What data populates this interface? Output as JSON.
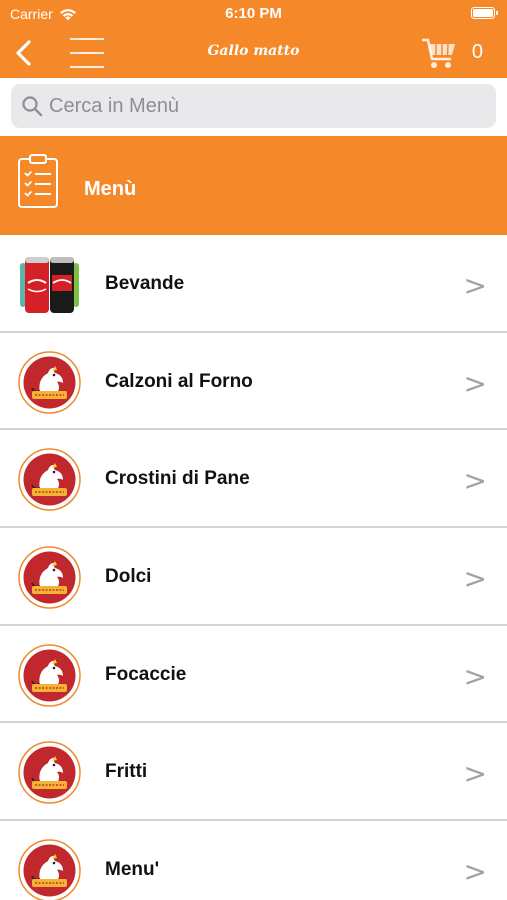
{
  "status_bar": {
    "carrier": "Carrier",
    "time": "6:10 PM"
  },
  "nav": {
    "title": "Gallo matto",
    "cart_count": "0"
  },
  "search": {
    "placeholder": "Cerca in Menù"
  },
  "section": {
    "title": "Menù"
  },
  "menu_items": [
    {
      "label": "Bevande",
      "icon": "drinks-cans-image"
    },
    {
      "label": "Calzoni al Forno",
      "icon": "gallo-matto-logo"
    },
    {
      "label": "Crostini di Pane",
      "icon": "gallo-matto-logo"
    },
    {
      "label": "Dolci",
      "icon": "gallo-matto-logo"
    },
    {
      "label": "Focaccie",
      "icon": "gallo-matto-logo"
    },
    {
      "label": "Fritti",
      "icon": "gallo-matto-logo"
    },
    {
      "label": "Menu'",
      "icon": "gallo-matto-logo"
    }
  ],
  "chevron_glyph": ">",
  "colors": {
    "accent": "#f5892a",
    "divider": "#d2d2d4",
    "logo_red": "#c0282d"
  }
}
